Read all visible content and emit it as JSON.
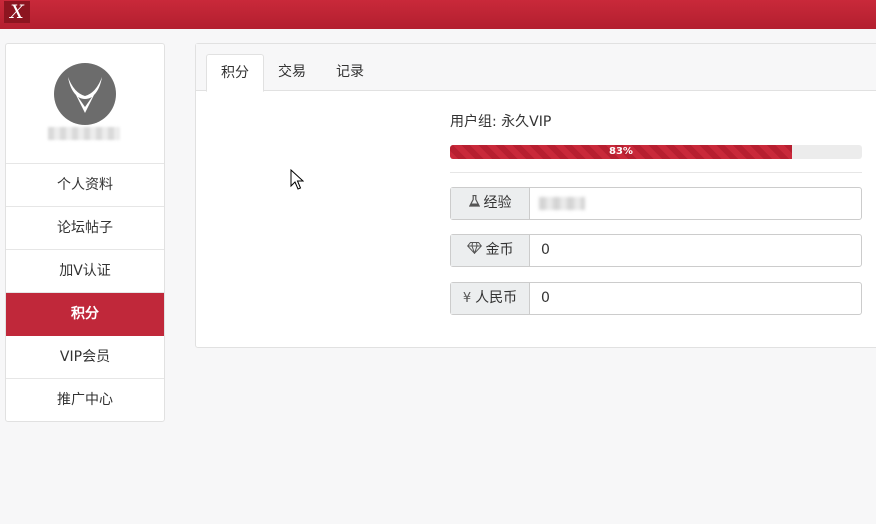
{
  "topbar": {
    "logo_text": "X",
    "accent": "#c0283a"
  },
  "sidebar": {
    "items": [
      {
        "label": "个人资料"
      },
      {
        "label": "论坛帖子"
      },
      {
        "label": "加V认证"
      },
      {
        "label": "积分",
        "active": true
      },
      {
        "label": "VIP会员"
      },
      {
        "label": "推广中心"
      }
    ]
  },
  "tabs": [
    {
      "label": "积分",
      "active": true
    },
    {
      "label": "交易"
    },
    {
      "label": "记录"
    }
  ],
  "points": {
    "group_label": "用户组: 永久VIP",
    "progress_text": "83%",
    "progress_value": 0.83,
    "fields": [
      {
        "icon": "flask-icon",
        "label": "经验",
        "value": ""
      },
      {
        "icon": "diamond-icon",
        "label": "金币",
        "value": "0"
      },
      {
        "icon": "yen-icon",
        "symbol": "¥",
        "label": "人民币",
        "value": "0"
      }
    ]
  }
}
